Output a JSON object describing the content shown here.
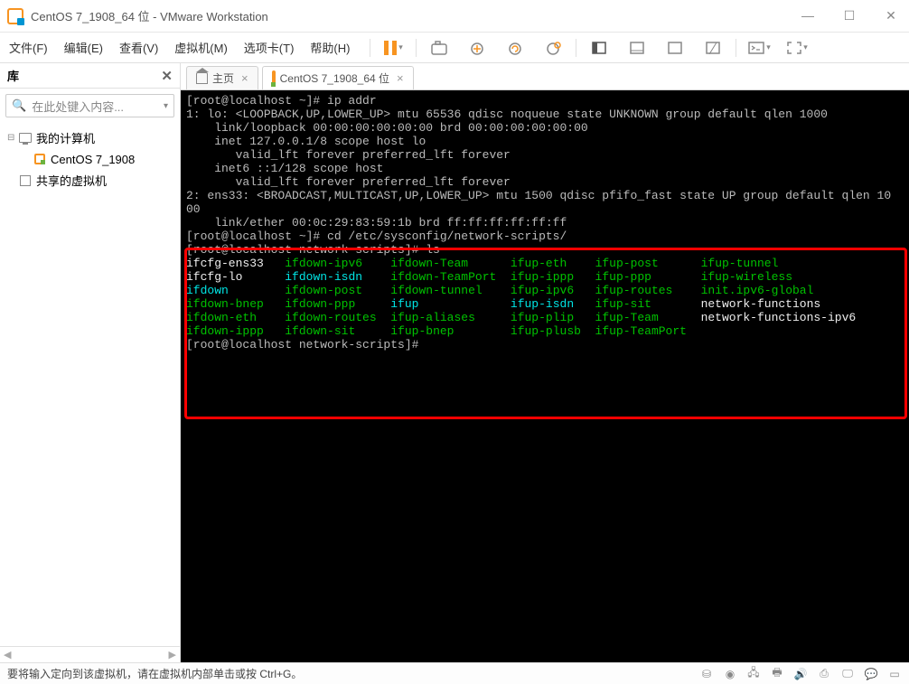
{
  "window": {
    "title": "CentOS 7_1908_64 位 - VMware Workstation"
  },
  "menu": {
    "file": "文件(F)",
    "edit": "编辑(E)",
    "view": "查看(V)",
    "vm": "虚拟机(M)",
    "tabs": "选项卡(T)",
    "help": "帮助(H)"
  },
  "sidebar": {
    "title": "库",
    "search_placeholder": "在此处键入内容...",
    "root": "我的计算机",
    "vm": "CentOS 7_1908",
    "shared": "共享的虚拟机"
  },
  "tabs": {
    "home": "主页",
    "vm": "CentOS 7_1908_64 位"
  },
  "terminal": {
    "l1": "[root@localhost ~]# ip addr",
    "l2": "1: lo: <LOOPBACK,UP,LOWER_UP> mtu 65536 qdisc noqueue state UNKNOWN group default qlen 1000",
    "l3": "    link/loopback 00:00:00:00:00:00 brd 00:00:00:00:00:00",
    "l4": "    inet 127.0.0.1/8 scope host lo",
    "l5": "       valid_lft forever preferred_lft forever",
    "l6": "    inet6 ::1/128 scope host ",
    "l7": "       valid_lft forever preferred_lft forever",
    "l8": "2: ens33: <BROADCAST,MULTICAST,UP,LOWER_UP> mtu 1500 qdisc pfifo_fast state UP group default qlen 10",
    "l8b": "00",
    "l9": "    link/ether 00:0c:29:83:59:1b brd ff:ff:ff:ff:ff:ff",
    "p1": "[root@localhost ~]# cd /etc/sysconfig/network-scripts/",
    "p2": "[root@localhost network-scripts]# ls",
    "r1c1": "ifcfg-ens33",
    "r1c2": "ifdown-ipv6",
    "r1c3": "ifdown-Team",
    "r1c4": "ifup-eth",
    "r1c5": "ifup-post",
    "r1c6": "ifup-tunnel",
    "r2c1": "ifcfg-lo",
    "r2c2": "ifdown-isdn",
    "r2c3": "ifdown-TeamPort",
    "r2c4": "ifup-ippp",
    "r2c5": "ifup-ppp",
    "r2c6": "ifup-wireless",
    "r3c1": "ifdown",
    "r3c2": "ifdown-post",
    "r3c3": "ifdown-tunnel",
    "r3c4": "ifup-ipv6",
    "r3c5": "ifup-routes",
    "r3c6": "init.ipv6-global",
    "r4c1": "ifdown-bnep",
    "r4c2": "ifdown-ppp",
    "r4c3": "ifup",
    "r4c4": "ifup-isdn",
    "r4c5": "ifup-sit",
    "r4c6": "network-functions",
    "r5c1": "ifdown-eth",
    "r5c2": "ifdown-routes",
    "r5c3": "ifup-aliases",
    "r5c4": "ifup-plip",
    "r5c5": "ifup-Team",
    "r5c6": "network-functions-ipv6",
    "r6c1": "ifdown-ippp",
    "r6c2": "ifdown-sit",
    "r6c3": "ifup-bnep",
    "r6c4": "ifup-plusb",
    "r6c5": "ifup-TeamPort",
    "p3": "[root@localhost network-scripts]# "
  },
  "status": {
    "text": "要将输入定向到该虚拟机，请在虚拟机内部单击或按 Ctrl+G。"
  }
}
